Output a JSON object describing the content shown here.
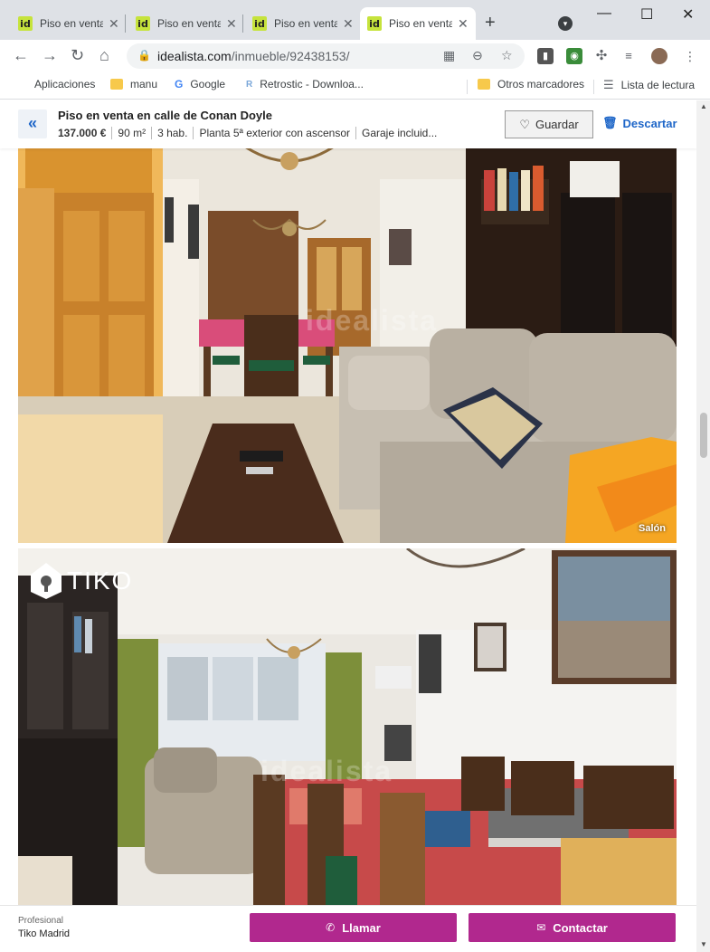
{
  "browser": {
    "tabs": [
      {
        "label": "Piso en venta",
        "favicon": "id",
        "active": false
      },
      {
        "label": "Piso en venta",
        "favicon": "id",
        "active": false
      },
      {
        "label": "Piso en venta",
        "favicon": "id",
        "active": false
      },
      {
        "label": "Piso en venta",
        "favicon": "id",
        "active": true
      }
    ],
    "new_tab_symbol": "+",
    "window_controls": {
      "minimize": "—",
      "maximize": "☐",
      "close": "✕"
    },
    "url_domain": "idealista.com",
    "url_path": "/inmueble/92438153/",
    "bookmarks": [
      {
        "label": "Aplicaciones",
        "icon": "apps-grid-icon"
      },
      {
        "label": "manu",
        "icon": "folder-icon"
      },
      {
        "label": "Google",
        "icon": "google-icon"
      },
      {
        "label": "Retrostic - Downloa...",
        "icon": "retrostic-icon"
      },
      {
        "label": "Otros marcadores",
        "icon": "folder-icon"
      },
      {
        "label": "Lista de lectura",
        "icon": "reading-list-icon"
      }
    ]
  },
  "listing": {
    "back_symbol": "«",
    "title": "Piso en venta en calle de Conan Doyle",
    "facts": [
      "137.000 €",
      "90 m²",
      "3 hab.",
      "Planta 5ª exterior con ascensor",
      "Garaje incluid..."
    ],
    "save_label": "Guardar",
    "discard_label": "Descartar",
    "photos": [
      {
        "caption": "Salón",
        "logo": "",
        "watermark": "idealista"
      },
      {
        "caption": "",
        "logo": "TIKO",
        "watermark": "idealista"
      }
    ]
  },
  "footer": {
    "advertiser_type": "Profesional",
    "advertiser_name": "Tiko Madrid",
    "call_label": "Llamar",
    "contact_label": "Contactar"
  },
  "colors": {
    "accent": "#b1288e",
    "link": "#1e66c8",
    "favicon": "#c6e33c"
  }
}
